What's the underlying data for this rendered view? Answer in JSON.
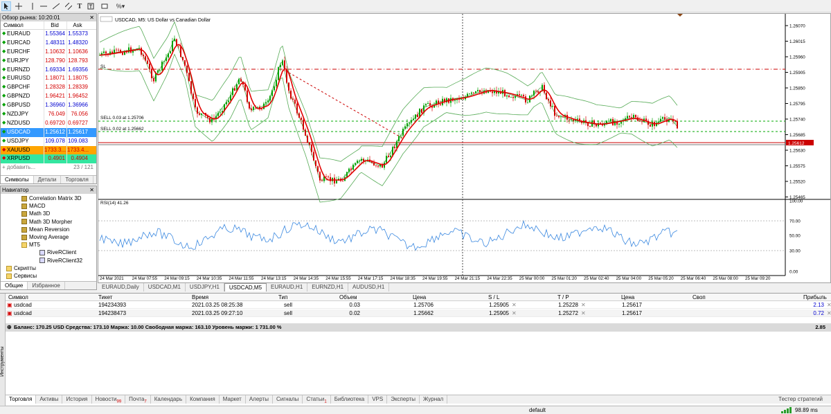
{
  "toolbar": {
    "icons": [
      "cursor-icon",
      "crosshair-icon",
      "vertical-line-icon",
      "horizontal-line-icon",
      "trendline-icon",
      "channel-icon",
      "text-icon",
      "label-icon",
      "shapes-icon"
    ]
  },
  "market_watch": {
    "title": "Обзор рынка: 10:20:01",
    "columns": {
      "symbol": "Символ",
      "bid": "Bid",
      "ask": "Ask"
    },
    "rows": [
      {
        "symbol": "EURAUD",
        "bid": "1.55364",
        "ask": "1.55373",
        "dir": "up",
        "color": "blue"
      },
      {
        "symbol": "EURCAD",
        "bid": "1.48311",
        "ask": "1.48320",
        "dir": "up",
        "color": "blue"
      },
      {
        "symbol": "EURCHF",
        "bid": "1.10632",
        "ask": "1.10636",
        "dir": "up",
        "color": "red"
      },
      {
        "symbol": "EURJPY",
        "bid": "128.790",
        "ask": "128.793",
        "dir": "up",
        "color": "red"
      },
      {
        "symbol": "EURNZD",
        "bid": "1.69334",
        "ask": "1.69356",
        "dir": "up",
        "color": "blue"
      },
      {
        "symbol": "EURUSD",
        "bid": "1.18071",
        "ask": "1.18075",
        "dir": "up",
        "color": "red"
      },
      {
        "symbol": "GBPCHF",
        "bid": "1.28328",
        "ask": "1.28339",
        "dir": "up",
        "color": "red"
      },
      {
        "symbol": "GBPNZD",
        "bid": "1.96421",
        "ask": "1.96452",
        "dir": "up",
        "color": "red"
      },
      {
        "symbol": "GBPUSD",
        "bid": "1.36960",
        "ask": "1.36966",
        "dir": "up",
        "color": "blue"
      },
      {
        "symbol": "NZDJPY",
        "bid": "76.049",
        "ask": "76.056",
        "dir": "up",
        "color": "red"
      },
      {
        "symbol": "NZDUSD",
        "bid": "0.69720",
        "ask": "0.69727",
        "dir": "up",
        "color": "red"
      },
      {
        "symbol": "USDCAD",
        "bid": "1.25612",
        "ask": "1.25617",
        "dir": "up",
        "color": "blue"
      },
      {
        "symbol": "USDJPY",
        "bid": "109.078",
        "ask": "109.083",
        "dir": "up",
        "color": "blue"
      },
      {
        "symbol": "XAUUSD",
        "bid": "1733.3...",
        "ask": "1733.4...",
        "dir": "down",
        "color": "red"
      },
      {
        "symbol": "XRPUSD",
        "bid": "0.4901",
        "ask": "0.4904",
        "dir": "down",
        "color": "red"
      }
    ],
    "add_label": "+ добавить...",
    "count": "23 / 121",
    "tabs": [
      "Символы",
      "Детали",
      "Торговля"
    ]
  },
  "navigator": {
    "title": "Навигатор",
    "items": [
      "Correlation Matrix 3D",
      "MACD",
      "Math 3D",
      "Math 3D Morpher",
      "Mean Reversion",
      "Moving Average",
      "MT5",
      "RiveRClient",
      "RiveRClient32",
      "Скрипты",
      "Сервисы"
    ],
    "tabs": [
      "Общие",
      "Избранное"
    ]
  },
  "chart": {
    "title": "USDCAD, M5:  US Dollar vs Canadian Dollar",
    "rsi_label": "RSI(14) 41.26",
    "sl_label": "SL",
    "sell1_label": "SELL 0.03 at 1.25706",
    "sell2_label": "SELL 0.02 at 1.25662",
    "price_ticks": [
      "1.26070",
      "1.26015",
      "1.25960",
      "1.25905",
      "1.25850",
      "1.25795",
      "1.25740",
      "1.25685",
      "1.25630",
      "1.25575",
      "1.25520",
      "1.25465"
    ],
    "current_price": "1.25612",
    "rsi_ticks": [
      "100.00",
      "70.00",
      "50.00",
      "30.00",
      "0.00"
    ],
    "time_ticks": [
      "24 Mar 2021",
      "24 Mar 07:55",
      "24 Mar 09:15",
      "24 Mar 10:35",
      "24 Mar 11:55",
      "24 Mar 13:15",
      "24 Mar 14:35",
      "24 Mar 15:55",
      "24 Mar 17:15",
      "24 Mar 18:35",
      "24 Mar 19:55",
      "24 Mar 21:15",
      "24 Mar 22:35",
      "25 Mar 00:00",
      "25 Mar 01:20",
      "25 Mar 02:40",
      "25 Mar 04:00",
      "25 Mar 05:20",
      "25 Mar 06:40",
      "25 Mar 08:00",
      "25 Mar 09:20"
    ],
    "tabs": [
      "EURAUD,Daily",
      "USDCAD,M1",
      "USDJPY,H1",
      "USDCAD,M5",
      "EURAUD,H1",
      "EURNZD,H1",
      "AUDUSD,H1"
    ],
    "active_tab": "USDCAD,M5"
  },
  "terminal": {
    "columns": [
      "Символ",
      "Тикет",
      "Время",
      "Тип",
      "Объем",
      "Цена",
      "S / L",
      "T / P",
      "Цена",
      "Своп",
      "Прибыль"
    ],
    "rows": [
      {
        "symbol": "usdcad",
        "ticket": "194234393",
        "time": "2021.03.25 08:25:38",
        "type": "sell",
        "volume": "0.03",
        "price": "1.25706",
        "sl": "1.25905",
        "tp": "1.25228",
        "cur": "1.25617",
        "swap": "",
        "profit": "2.13"
      },
      {
        "symbol": "usdcad",
        "ticket": "194238473",
        "time": "2021.03.25 09:27:10",
        "type": "sell",
        "volume": "0.02",
        "price": "1.25662",
        "sl": "1.25905",
        "tp": "1.25272",
        "cur": "1.25617",
        "swap": "",
        "profit": "0.72"
      }
    ],
    "balance_text": "Баланс: 170.25 USD  Средства: 173.10  Маржа: 10.00  Свободная маржа: 163.10  Уровень маржи: 1 731.00 %",
    "total_profit": "2.85",
    "side_label": "Инструменты",
    "tabs": [
      {
        "label": "Торговля",
        "badge": ""
      },
      {
        "label": "Активы",
        "badge": ""
      },
      {
        "label": "История",
        "badge": ""
      },
      {
        "label": "Новости",
        "badge": "99"
      },
      {
        "label": "Почта",
        "badge": "7"
      },
      {
        "label": "Календарь",
        "badge": ""
      },
      {
        "label": "Компания",
        "badge": ""
      },
      {
        "label": "Маркет",
        "badge": ""
      },
      {
        "label": "Алерты",
        "badge": ""
      },
      {
        "label": "Сигналы",
        "badge": ""
      },
      {
        "label": "Статьи",
        "badge": "1"
      },
      {
        "label": "Библиотека",
        "badge": ""
      },
      {
        "label": "VPS",
        "badge": ""
      },
      {
        "label": "Эксперты",
        "badge": ""
      },
      {
        "label": "Журнал",
        "badge": ""
      }
    ],
    "tester_label": "Тестер стратегий"
  },
  "status": {
    "profile": "default",
    "ping": "98.89 ms"
  },
  "colors": {
    "candle_up": "#00a000",
    "candle_down": "#d40000",
    "ma": "#e00000",
    "bands": "#55aa55",
    "rsi": "#3a88e0",
    "selected_row": "#3399ff"
  }
}
